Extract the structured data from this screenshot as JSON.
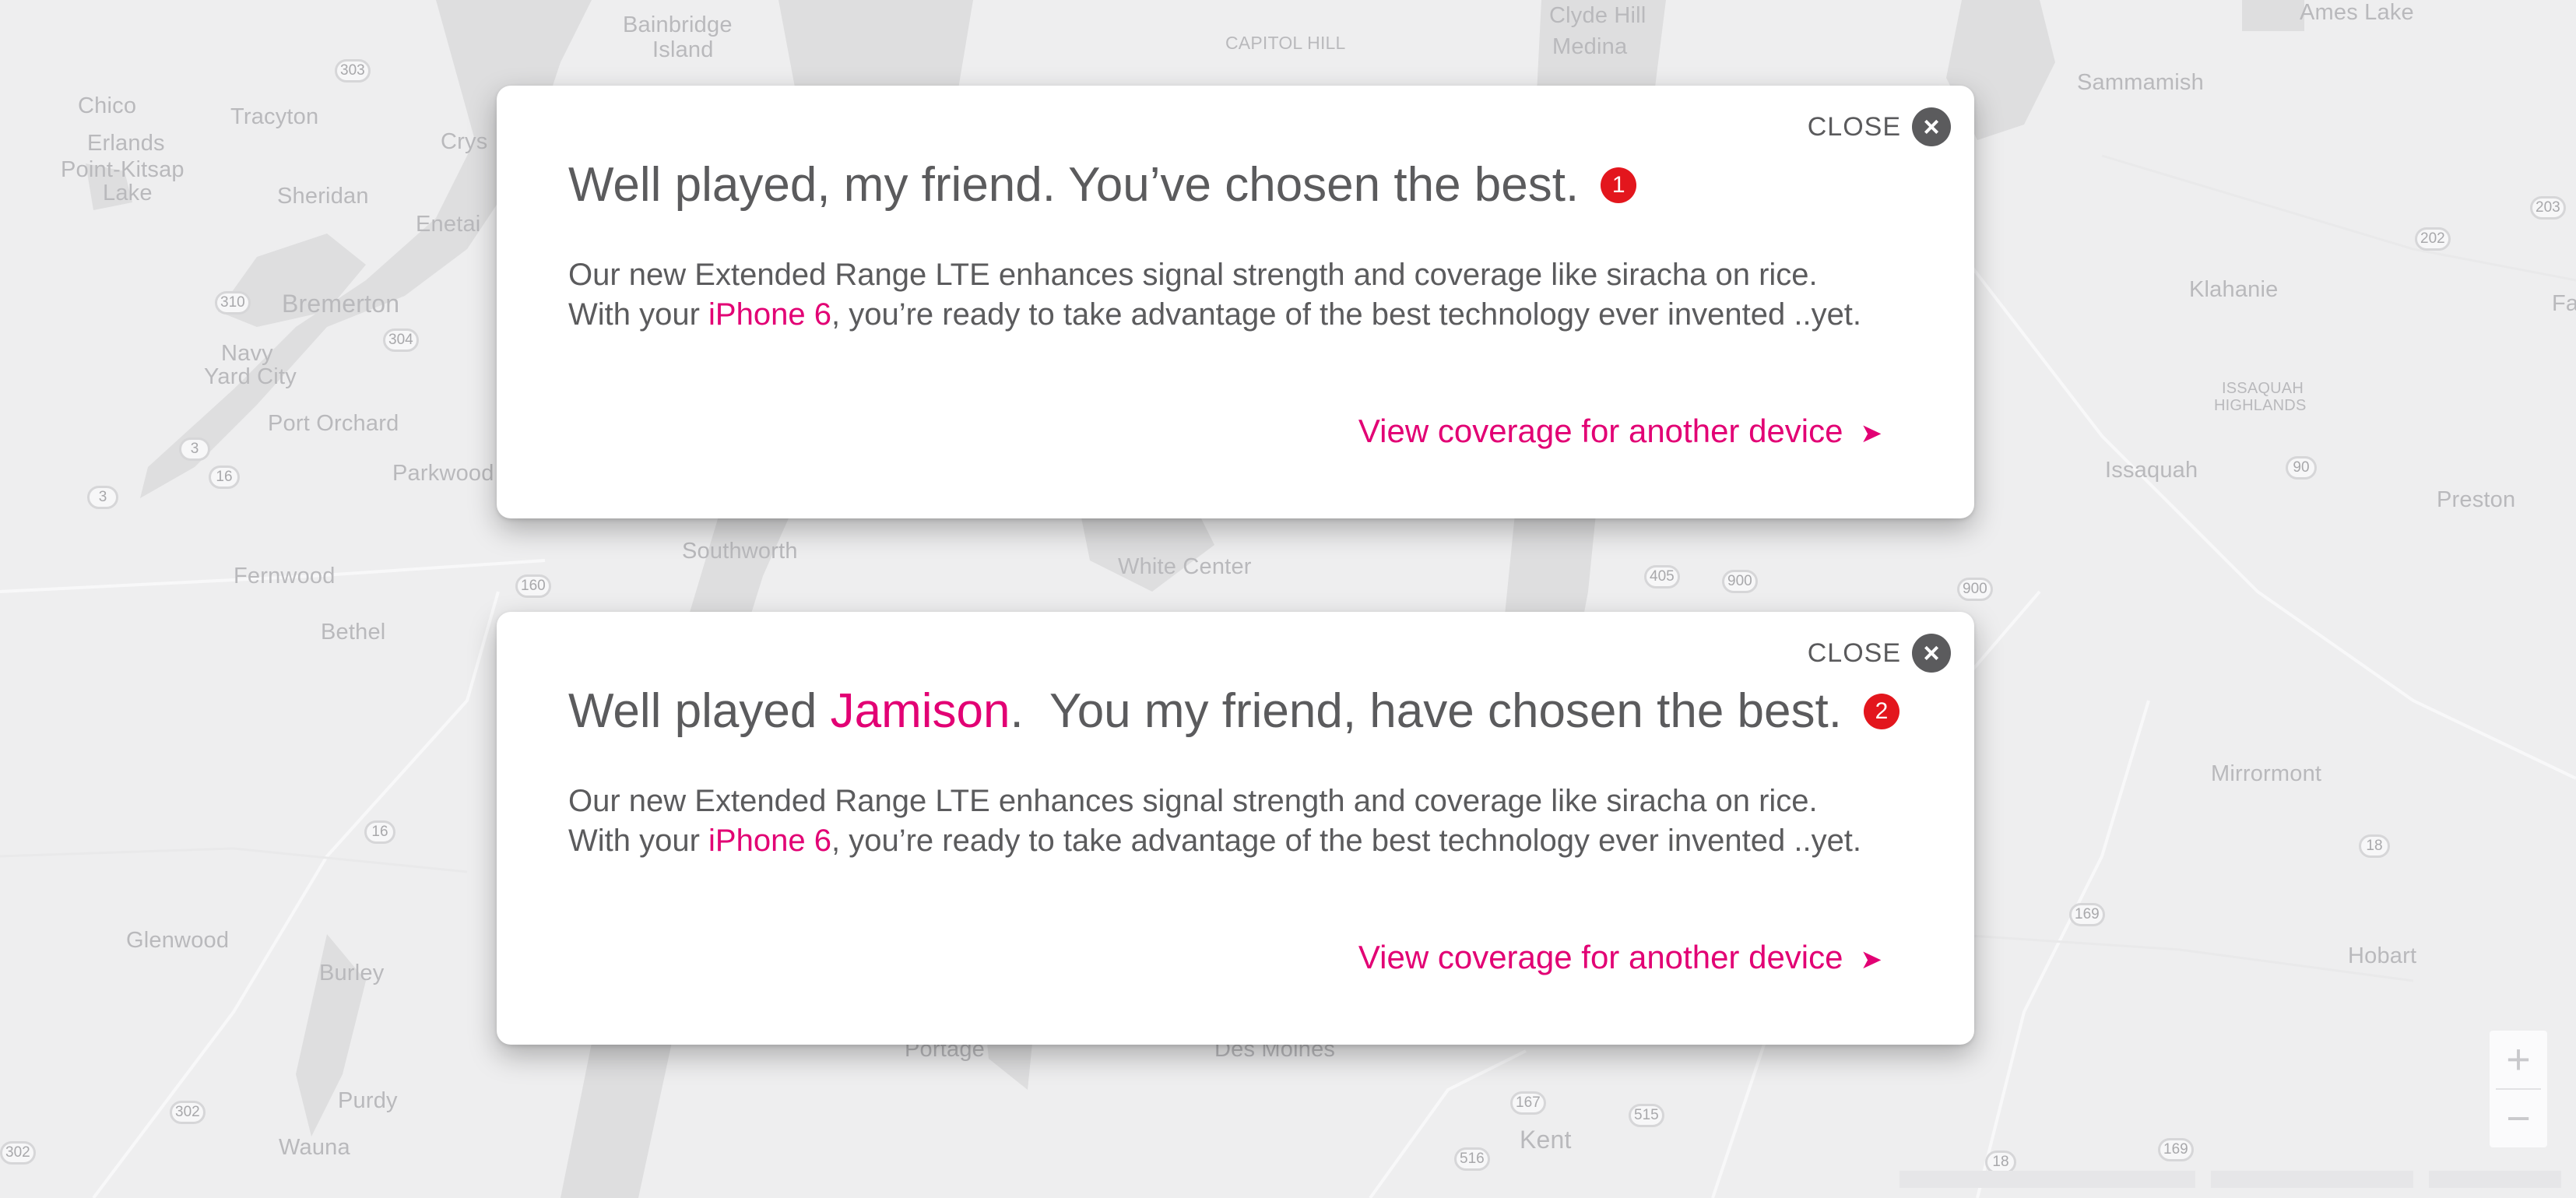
{
  "map": {
    "places": [
      {
        "name": "Bainbridge"
      },
      {
        "name": "Island"
      },
      {
        "name": "Chico"
      },
      {
        "name": "Erlands"
      },
      {
        "name": "Point-Kitsap"
      },
      {
        "name": "Lake"
      },
      {
        "name": "Tracyton"
      },
      {
        "name": "Sheridan"
      },
      {
        "name": "Enetai"
      },
      {
        "name": "Bremerton"
      },
      {
        "name": "Navy"
      },
      {
        "name": "Yard City"
      },
      {
        "name": "Port Orchard"
      },
      {
        "name": "Parkwood"
      },
      {
        "name": "Fernwood"
      },
      {
        "name": "Bethel"
      },
      {
        "name": "Southworth"
      },
      {
        "name": "White Center"
      },
      {
        "name": "Glenwood"
      },
      {
        "name": "Burley"
      },
      {
        "name": "Purdy"
      },
      {
        "name": "Wauna"
      },
      {
        "name": "Portage"
      },
      {
        "name": "Des Moines"
      },
      {
        "name": "Kent"
      },
      {
        "name": "CAPITOL HILL"
      },
      {
        "name": "Clyde Hill"
      },
      {
        "name": "Medina"
      },
      {
        "name": "Sammamish"
      },
      {
        "name": "Ames Lake"
      },
      {
        "name": "Klahanie"
      },
      {
        "name": "ISSAQUAH"
      },
      {
        "name": "HIGHLANDS"
      },
      {
        "name": "Issaquah"
      },
      {
        "name": "Preston"
      },
      {
        "name": "Mirrormont"
      },
      {
        "name": "Hobart"
      },
      {
        "name": "Fa"
      },
      {
        "name": "Crys"
      }
    ],
    "shields": [
      "303",
      "310",
      "304",
      "3",
      "16",
      "3",
      "160",
      "16",
      "302",
      "302",
      "405",
      "900",
      "900",
      "202",
      "203",
      "90",
      "18",
      "169",
      "167",
      "515",
      "516",
      "18",
      "169"
    ],
    "zoom": {
      "in_label": "+",
      "out_label": "−"
    }
  },
  "modals": [
    {
      "close_label": "CLOSE",
      "close_icon": "close-icon",
      "headline": "Well played, my friend. You’ve chosen the best.",
      "step": "1",
      "line1": "Our new Extended Range LTE enhances signal strength and coverage like siracha on rice.",
      "line2_prefix": "With your ",
      "device": "iPhone 6",
      "line2_suffix": ", you’re ready to take advantage of the best technology ever invented ..yet.",
      "cta": "View coverage for another device",
      "cta_arrow": "➤"
    },
    {
      "close_label": "CLOSE",
      "close_icon": "close-icon",
      "headline_prefix": "Well played ",
      "user_name": "Jamison",
      "headline_suffix": ".  You my friend, have chosen the best.",
      "step": "2",
      "line1": "Our new Extended Range LTE enhances signal strength and coverage like siracha on rice.",
      "line2_prefix": "With your ",
      "device": "iPhone 6",
      "line2_suffix": ", you’re ready to take advantage of the best technology ever invented ..yet.",
      "cta": "View coverage for another device",
      "cta_arrow": "➤"
    }
  ],
  "colors": {
    "accent": "#e20074",
    "badge": "#e3161d",
    "text": "#5b5b5d",
    "map_land": "#eeeeef",
    "map_water": "#dcdcdf"
  }
}
